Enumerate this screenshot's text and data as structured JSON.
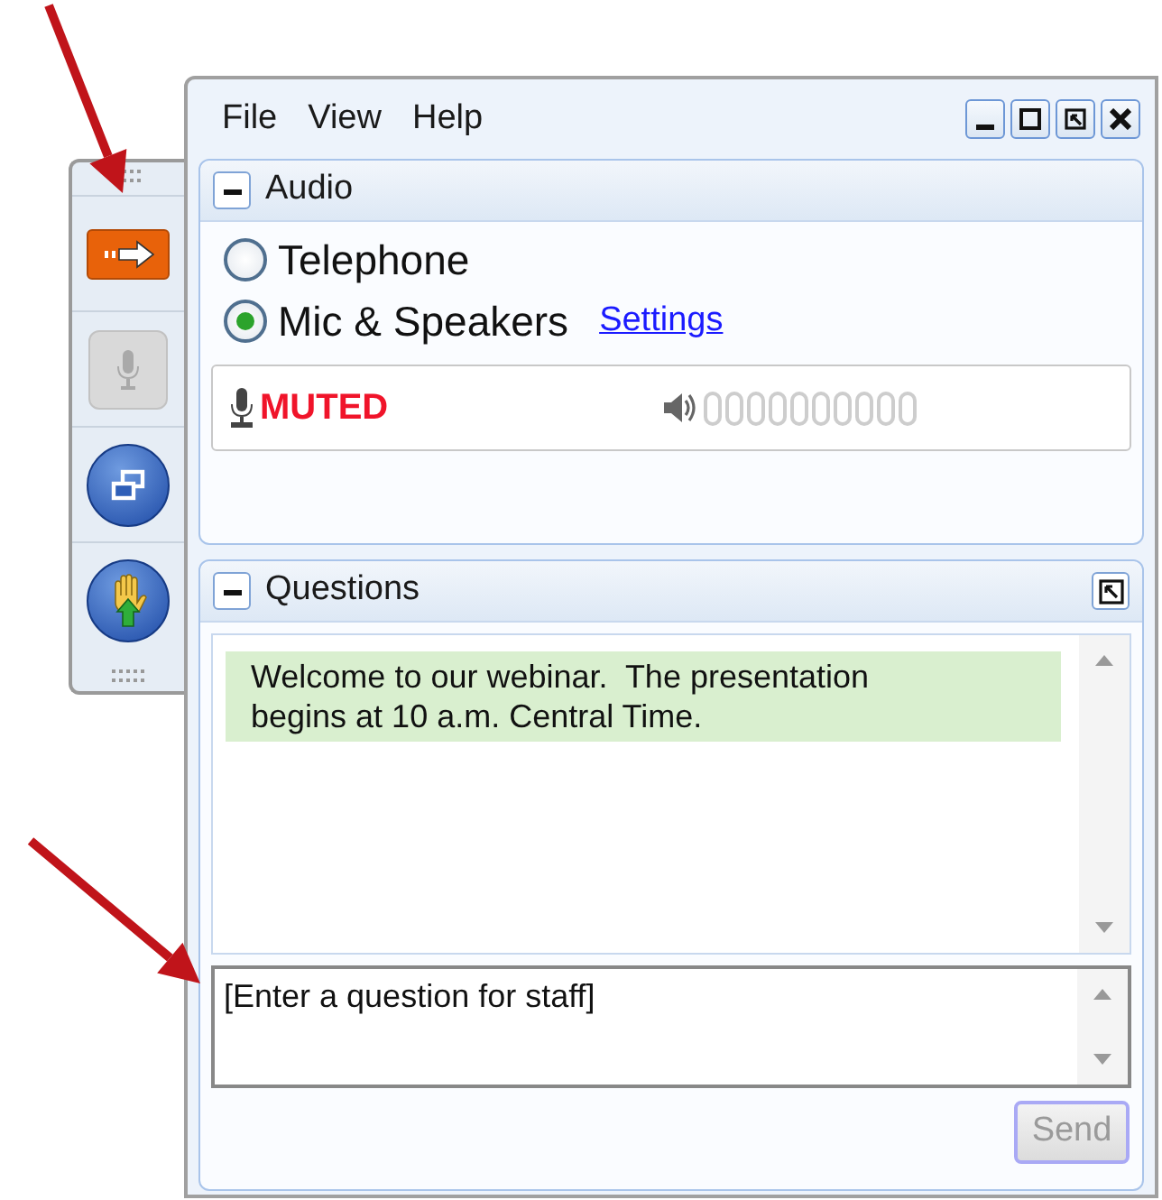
{
  "menu": [
    "File",
    "View",
    "Help"
  ],
  "window_controls": [
    {
      "kind": "minimize"
    },
    {
      "kind": "maximize"
    },
    {
      "kind": "restore"
    },
    {
      "kind": "close"
    }
  ],
  "toolbar": [
    {
      "kind": "arrow"
    },
    {
      "kind": "mic",
      "disabled": true
    },
    {
      "kind": "window"
    },
    {
      "kind": "hand"
    }
  ],
  "audio": {
    "title": "Audio",
    "expanded": true,
    "options": [
      {
        "label": "Telephone",
        "selected": false
      },
      {
        "label": "Mic & Speakers",
        "selected": true
      }
    ],
    "settings_link": "Settings",
    "mic_status": "MUTED"
  },
  "questions": {
    "title": "Questions",
    "expanded": true,
    "messages": [
      "Welcome to our webinar.  The presentation begins at 10 a.m. Central Time."
    ],
    "input": {
      "placeholder": "[Enter a question for staff]"
    },
    "send": {
      "label": "Send",
      "disabled": true
    }
  }
}
